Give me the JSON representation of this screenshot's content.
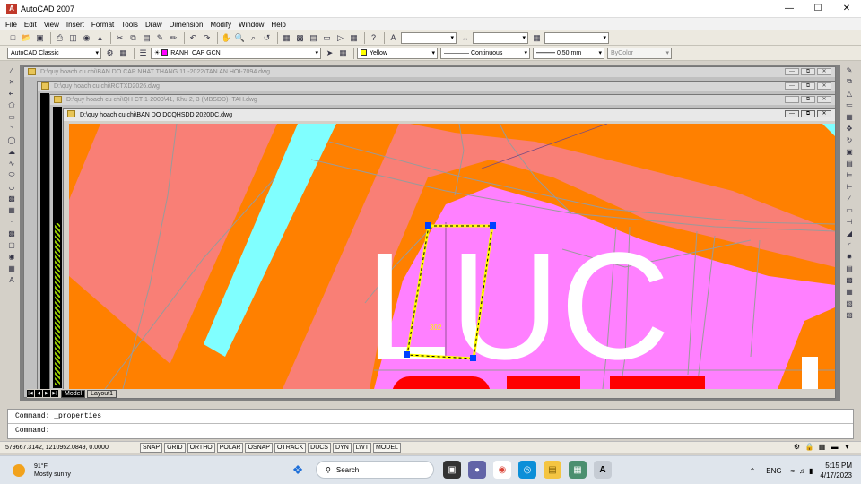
{
  "window": {
    "title": "AutoCAD 2007",
    "icon_letter": "A"
  },
  "menu": [
    "File",
    "Edit",
    "View",
    "Insert",
    "Format",
    "Tools",
    "Draw",
    "Dimension",
    "Modify",
    "Window",
    "Help"
  ],
  "toolbar2": {
    "workspace": "AutoCAD Classic",
    "layer": "RANH_CAP GCN",
    "color": "Yellow",
    "color_hex": "#ffff00",
    "linetype": "Continuous",
    "lineweight": "0.50 mm",
    "plotstyle": "ByColor"
  },
  "documents": [
    "D:\\quy hoach cu chi\\BAN DO CAP NHAT THANG 11 -2022\\TAN AN HOI-7094.dwg",
    "D:\\quy hoach cu chi\\RCTXD2026.dwg",
    "D:\\quy hoach cu chi\\QH CT 1-2000\\41, Khu 2, 3 (MBSDD)- TAH.dwg",
    "D:\\quy hoach cu chi\\BAN DO DCQHSDD 2020DC.dwg"
  ],
  "drawing": {
    "big_label": "LUC",
    "parcel_number": "302",
    "colors": {
      "salmon": "#f97f76",
      "orange": "#ff8000",
      "cyan": "#80ffff",
      "magenta": "#ff80ff",
      "red": "#ff0000",
      "selection": "#ffff00",
      "grips": "#0040ff"
    }
  },
  "layout_tabs": [
    {
      "label": "Model",
      "active": true
    },
    {
      "label": "Layout1",
      "active": false
    }
  ],
  "command": {
    "history": "Command: _properties",
    "prompt": "Command:"
  },
  "status": {
    "coords": "579667.3142, 1210952.0849, 0.0000",
    "toggles": [
      "SNAP",
      "GRID",
      "ORTHO",
      "POLAR",
      "OSNAP",
      "OTRACK",
      "DUCS",
      "DYN",
      "LWT",
      "MODEL"
    ]
  },
  "taskbar": {
    "temperature": "91°F",
    "weather": "Mostly sunny",
    "search_placeholder": "Search",
    "language": "ENG",
    "time": "5:15 PM",
    "date": "4/17/2023"
  }
}
